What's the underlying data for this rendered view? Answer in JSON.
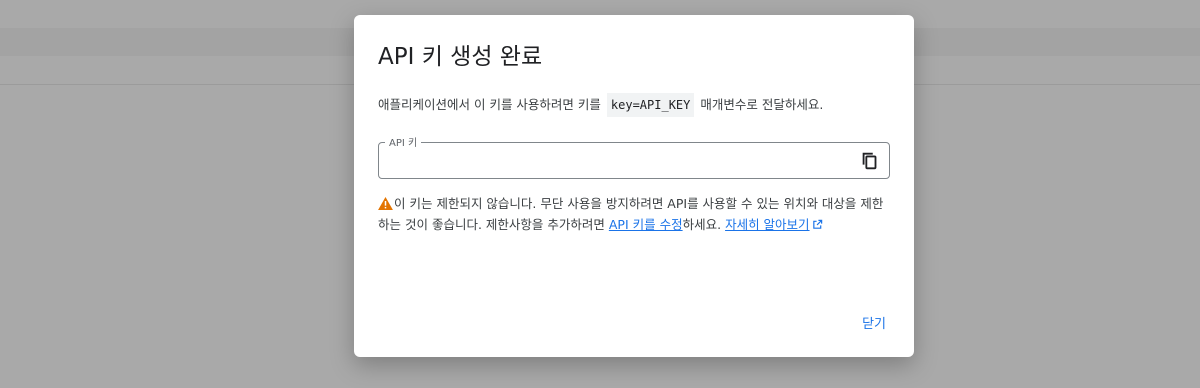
{
  "dialog": {
    "title": "API 키 생성 완료",
    "description_before": "애플리케이션에서 이 키를 사용하려면 키를",
    "description_code": "key=API_KEY",
    "description_after": "매개변수로 전달하세요.",
    "field_label": "API 키",
    "field_value": "",
    "copy_icon": "copy-icon",
    "warning": {
      "icon": "warning-icon",
      "text_before": "이 키는 제한되지 않습니다. 무단 사용을 방지하려면 API를 사용할 수 있는 위치와 대상을 제한하는 것이 좋습니다. 제한사항을 추가하려면",
      "edit_link": "API 키를 수정",
      "text_middle": "하세요.",
      "learn_more_link": "자세히 알아보기",
      "external_icon": "external-link-icon"
    },
    "close_label": "닫기",
    "accent_color": "#1a73e8",
    "warning_color": "#e37400"
  }
}
